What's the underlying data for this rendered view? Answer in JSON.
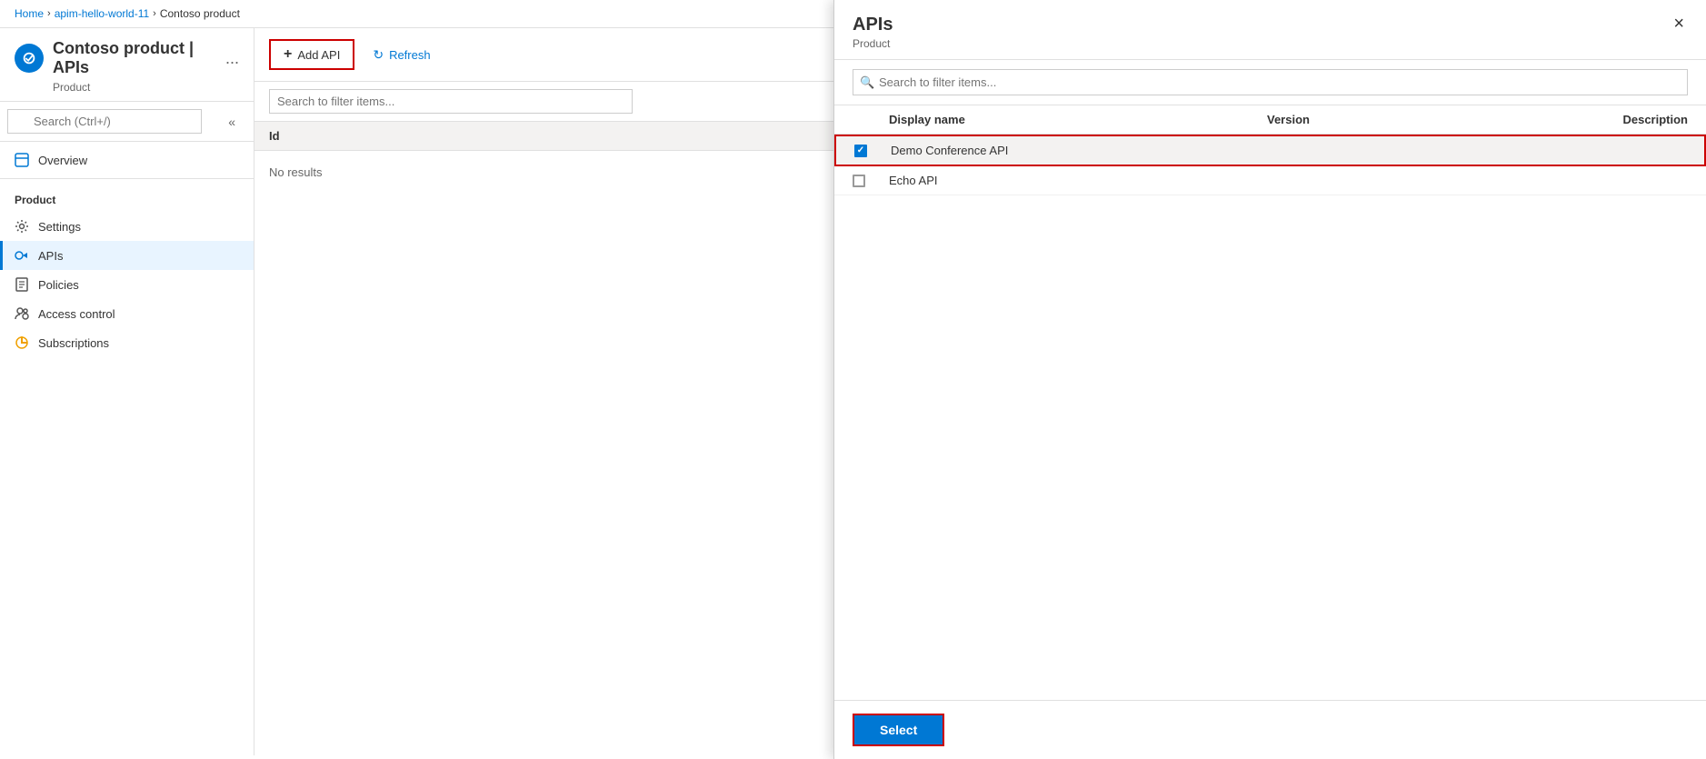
{
  "breadcrumb": {
    "home": "Home",
    "service": "apim-hello-world-11",
    "page": "Contoso product"
  },
  "page": {
    "title": "Contoso product | APIs",
    "subtitle": "Product",
    "more_options_label": "..."
  },
  "sidebar": {
    "search_placeholder": "Search (Ctrl+/)",
    "section_label": "Product",
    "items": [
      {
        "id": "overview",
        "label": "Overview",
        "icon": "overview"
      },
      {
        "id": "settings",
        "label": "Settings",
        "icon": "settings"
      },
      {
        "id": "apis",
        "label": "APIs",
        "icon": "apis",
        "active": true
      },
      {
        "id": "policies",
        "label": "Policies",
        "icon": "policies"
      },
      {
        "id": "access-control",
        "label": "Access control",
        "icon": "access"
      },
      {
        "id": "subscriptions",
        "label": "Subscriptions",
        "icon": "subscriptions"
      }
    ]
  },
  "toolbar": {
    "add_api_label": "Add API",
    "refresh_label": "Refresh"
  },
  "main_table": {
    "search_placeholder": "Search to filter items...",
    "col_id": "Id",
    "no_results": "No results"
  },
  "panel": {
    "title": "APIs",
    "subtitle": "Product",
    "search_placeholder": "Search to filter items...",
    "close_label": "×",
    "columns": {
      "display_name": "Display name",
      "version": "Version",
      "description": "Description"
    },
    "apis": [
      {
        "id": "demo-conference",
        "name": "Demo Conference API",
        "version": "",
        "description": "",
        "checked": true
      },
      {
        "id": "echo",
        "name": "Echo API",
        "version": "",
        "description": "",
        "checked": false
      }
    ],
    "select_button": "Select"
  }
}
